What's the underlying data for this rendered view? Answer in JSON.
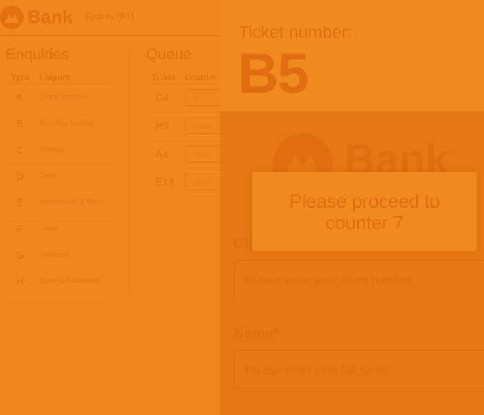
{
  "header": {
    "logo_text": "Bank",
    "branch": "Sydney (B1)"
  },
  "enquiries": {
    "title": "Enquiries",
    "col_type": "Type",
    "col_enquiry": "Enquiry",
    "rows": [
      {
        "type": "A",
        "name": "Online services"
      },
      {
        "type": "B",
        "name": "Everyday banking"
      },
      {
        "type": "C",
        "name": "Savings"
      },
      {
        "type": "D",
        "name": "Cards"
      },
      {
        "type": "E",
        "name": "International & Travel"
      },
      {
        "type": "F",
        "name": "Loans"
      },
      {
        "type": "G",
        "name": "Insurance"
      },
      {
        "type": "H",
        "name": "Super & Retirement"
      }
    ]
  },
  "queue": {
    "title": "Queue",
    "col_ticket": "Ticket",
    "col_counter": "Counter",
    "rows": [
      {
        "ticket": "C4",
        "counter": "4"
      },
      {
        "ticket": "H5",
        "counter": "Select"
      },
      {
        "ticket": "A4",
        "counter": "Select"
      },
      {
        "ticket": "E13",
        "counter": "Select"
      }
    ]
  },
  "ticket": {
    "label": "Ticket number:",
    "number": "B5"
  },
  "form": {
    "logo_text": "Bank",
    "client_label": "Cli",
    "client_placeholder": "Please enter your client number",
    "name_label": "Name*",
    "name_placeholder": "Please enter your full name"
  },
  "modal": {
    "message": "Please proceed to counter 7"
  },
  "colors": {
    "overlay": "#f0861e",
    "brand": "#e36f10"
  }
}
